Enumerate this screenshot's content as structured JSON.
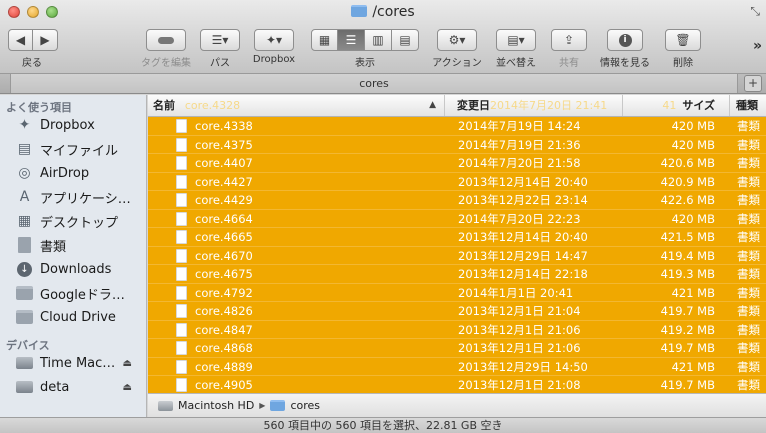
{
  "window": {
    "title": "/cores",
    "tab_title": "cores"
  },
  "toolbar": {
    "back_label": "戻る",
    "tags_label": "タグを編集",
    "path_label": "パス",
    "dropbox_label": "Dropbox",
    "view_label": "表示",
    "action_label": "アクション",
    "arrange_label": "並べ替え",
    "share_label": "共有",
    "info_label": "情報を見る",
    "delete_label": "削除"
  },
  "sidebar": {
    "favorites_heading": "よく使う項目",
    "favorites": [
      {
        "label": "Dropbox",
        "icon": "dropbox-icon"
      },
      {
        "label": "マイファイル",
        "icon": "my-files-icon"
      },
      {
        "label": "AirDrop",
        "icon": "airdrop-icon"
      },
      {
        "label": "アプリケーシ…",
        "icon": "applications-icon"
      },
      {
        "label": "デスクトップ",
        "icon": "desktop-icon"
      },
      {
        "label": "書類",
        "icon": "documents-icon"
      },
      {
        "label": "Downloads",
        "icon": "downloads-icon"
      },
      {
        "label": "Googleドラ…",
        "icon": "folder-icon"
      },
      {
        "label": "Cloud Drive",
        "icon": "folder-icon"
      }
    ],
    "devices_heading": "デバイス",
    "devices": [
      {
        "label": "Time Mac…",
        "icon": "disk-icon"
      },
      {
        "label": "deta",
        "icon": "disk-icon"
      }
    ]
  },
  "columns": {
    "name": "名前",
    "date": "変更日",
    "size": "サイズ",
    "kind": "種類",
    "ghost_name": "core.4328",
    "ghost_date": "2014年7月20日 21:41",
    "ghost_size": "41"
  },
  "files": [
    {
      "name": "core.4338",
      "date": "2014年7月19日 14:24",
      "size": "420 MB",
      "kind": "書類"
    },
    {
      "name": "core.4375",
      "date": "2014年7月19日 21:36",
      "size": "420 MB",
      "kind": "書類"
    },
    {
      "name": "core.4407",
      "date": "2014年7月20日 21:58",
      "size": "420.6 MB",
      "kind": "書類"
    },
    {
      "name": "core.4427",
      "date": "2013年12月14日 20:40",
      "size": "420.9 MB",
      "kind": "書類"
    },
    {
      "name": "core.4429",
      "date": "2013年12月22日 23:14",
      "size": "422.6 MB",
      "kind": "書類"
    },
    {
      "name": "core.4664",
      "date": "2014年7月20日 22:23",
      "size": "420 MB",
      "kind": "書類"
    },
    {
      "name": "core.4665",
      "date": "2013年12月14日 20:40",
      "size": "421.5 MB",
      "kind": "書類"
    },
    {
      "name": "core.4670",
      "date": "2013年12月29日 14:47",
      "size": "419.4 MB",
      "kind": "書類"
    },
    {
      "name": "core.4675",
      "date": "2013年12月14日 22:18",
      "size": "419.3 MB",
      "kind": "書類"
    },
    {
      "name": "core.4792",
      "date": "2014年1月1日 20:41",
      "size": "421 MB",
      "kind": "書類"
    },
    {
      "name": "core.4826",
      "date": "2013年12月1日 21:04",
      "size": "419.7 MB",
      "kind": "書類"
    },
    {
      "name": "core.4847",
      "date": "2013年12月1日 21:06",
      "size": "419.2 MB",
      "kind": "書類"
    },
    {
      "name": "core.4868",
      "date": "2013年12月1日 21:06",
      "size": "419.7 MB",
      "kind": "書類"
    },
    {
      "name": "core.4889",
      "date": "2013年12月29日 14:50",
      "size": "421 MB",
      "kind": "書類"
    },
    {
      "name": "core.4905",
      "date": "2013年12月1日 21:08",
      "size": "419.7 MB",
      "kind": "書類"
    }
  ],
  "pathbar": {
    "disk": "Macintosh HD",
    "folder": "cores"
  },
  "status": "560 項目中の 560 項目を選択、22.81 GB 空き",
  "colors": {
    "selection": "#f0a800",
    "sidebar_bg": "#e3e8ee"
  }
}
